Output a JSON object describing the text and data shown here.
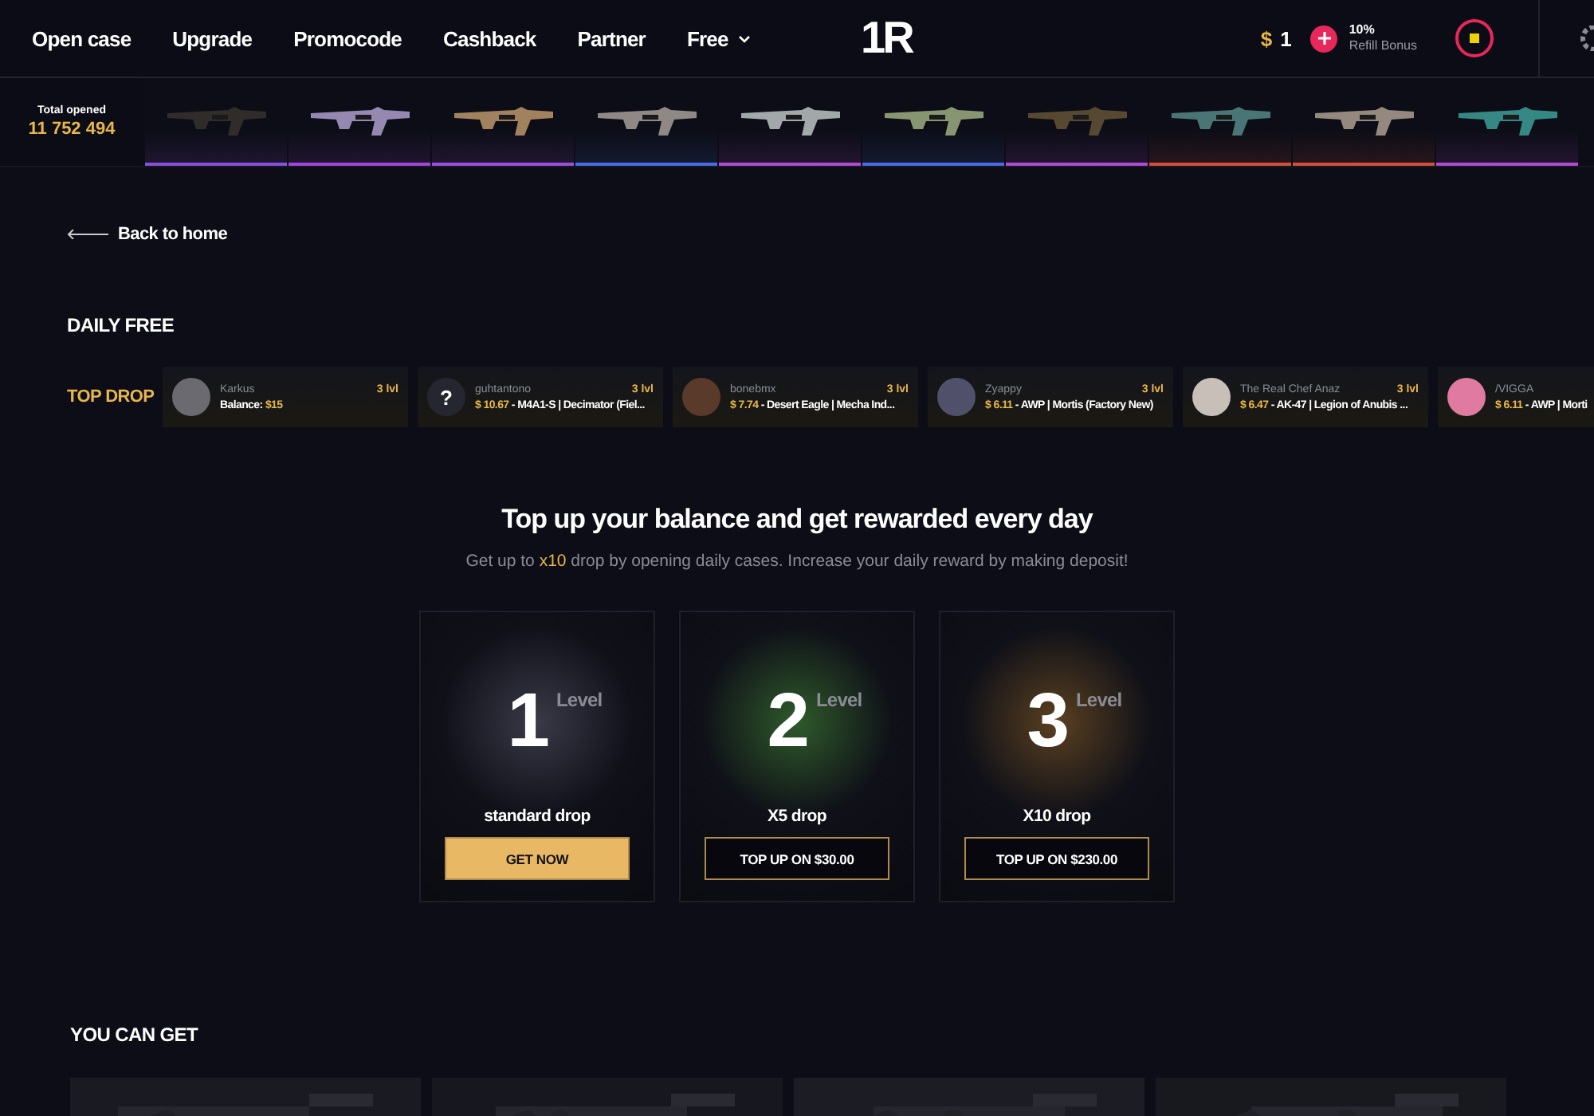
{
  "nav": [
    {
      "label": "Open case"
    },
    {
      "label": "Upgrade"
    },
    {
      "label": "Promocode"
    },
    {
      "label": "Cashback"
    },
    {
      "label": "Partner"
    },
    {
      "label": "Free",
      "dropdown": true
    }
  ],
  "logo": "1R",
  "balance": {
    "currency": "$",
    "amount": "1"
  },
  "refill": {
    "percent": "10%",
    "label": "Refill Bonus"
  },
  "live": {
    "total_label": "Total opened",
    "total": "11 752 494",
    "items": [
      {
        "color": "#8a4fd8"
      },
      {
        "color": "#a046d8"
      },
      {
        "color": "#9a4fd8"
      },
      {
        "color": "#4a6ae0"
      },
      {
        "color": "#b04ad0"
      },
      {
        "color": "#4a6ae0"
      },
      {
        "color": "#b04ad0"
      },
      {
        "color": "#d0503a"
      },
      {
        "color": "#d0503a"
      },
      {
        "color": "#b04ad0"
      }
    ]
  },
  "back": "Back to home",
  "daily_title": "DAILY FREE",
  "top_drop": {
    "label": "TOP DROP",
    "drops": [
      {
        "kind": "balance",
        "user": "Karkus",
        "level": "3 lvl",
        "prefix": "Balance:",
        "price": "$15"
      },
      {
        "kind": "drop",
        "user": "guhtantono",
        "level": "3 lvl",
        "avatar": "?",
        "price": "$ 10.67",
        "item": " - M4A1-S | Decimator (Fiel..."
      },
      {
        "kind": "drop",
        "user": "bonebmx",
        "level": "3 lvl",
        "price": "$ 7.74",
        "item": " - Desert Eagle | Mecha Ind..."
      },
      {
        "kind": "drop",
        "user": "Zyappy",
        "level": "3 lvl",
        "price": "$ 6.11",
        "item": " - AWP | Mortis (Factory New)"
      },
      {
        "kind": "drop",
        "user": "The Real Chef Anaz",
        "level": "3 lvl",
        "price": "$ 6.47",
        "item": " - AK-47 | Legion of Anubis ..."
      },
      {
        "kind": "drop",
        "user": "/VIGGA",
        "price": "$ 6.11",
        "item": " - AWP | Morti"
      }
    ]
  },
  "promo": {
    "title": "Top up your balance and get rewarded every day",
    "subtitle_before": "Get up to ",
    "subtitle_highlight": "x10",
    "subtitle_after": " drop by opening daily cases. Increase your daily reward by making deposit!"
  },
  "levels": [
    {
      "number": "1",
      "label": "Level",
      "reward": "standard drop",
      "button": "GET NOW",
      "kind": "filled",
      "color": "#3a3a48"
    },
    {
      "number": "2",
      "label": "Level",
      "reward": "X5 drop",
      "button": "TOP UP ON $30.00",
      "kind": "outline",
      "color": "#2f5a2a"
    },
    {
      "number": "3",
      "label": "Level",
      "reward": "X10 drop",
      "button": "TOP UP ON $230.00",
      "kind": "outline",
      "color": "#5a4020"
    }
  ],
  "you_can_get": {
    "title": "YOU CAN GET"
  }
}
